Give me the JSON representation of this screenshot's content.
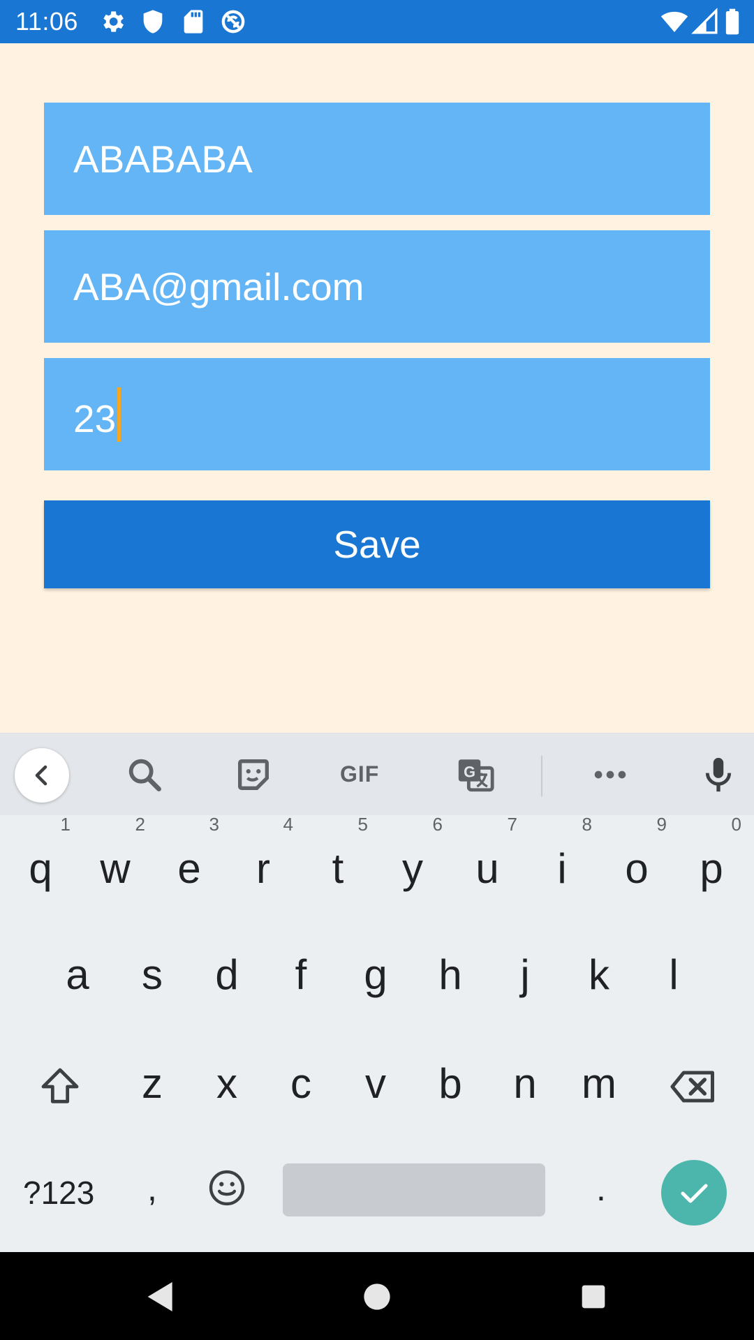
{
  "status_bar": {
    "time": "11:06",
    "left_icons": [
      "settings-icon",
      "shield-icon",
      "sd-card-icon",
      "sync-icon"
    ],
    "right_icons": [
      "wifi-icon",
      "signal-icon",
      "battery-icon"
    ],
    "background": "#1976D2"
  },
  "form": {
    "name_value": "ABABABA",
    "email_value": "ABA@gmail.com",
    "age_value": "23",
    "save_label": "Save",
    "field_color": "#64B5F6",
    "button_color": "#1976D2",
    "background": "#FFF2E0"
  },
  "keyboard": {
    "toolbar": {
      "items": [
        "back-chevron-icon",
        "search-icon",
        "sticker-icon",
        "gif",
        "translate-icon",
        "more-icon",
        "mic-icon"
      ],
      "gif_label": "GIF"
    },
    "row1": [
      {
        "key": "q",
        "hint": "1"
      },
      {
        "key": "w",
        "hint": "2"
      },
      {
        "key": "e",
        "hint": "3"
      },
      {
        "key": "r",
        "hint": "4"
      },
      {
        "key": "t",
        "hint": "5"
      },
      {
        "key": "y",
        "hint": "6"
      },
      {
        "key": "u",
        "hint": "7"
      },
      {
        "key": "i",
        "hint": "8"
      },
      {
        "key": "o",
        "hint": "9"
      },
      {
        "key": "p",
        "hint": "0"
      }
    ],
    "row2": [
      "a",
      "s",
      "d",
      "f",
      "g",
      "h",
      "j",
      "k",
      "l"
    ],
    "row3": [
      "z",
      "x",
      "c",
      "v",
      "b",
      "n",
      "m"
    ],
    "bottom": {
      "symbols_label": "?123",
      "comma": ",",
      "period": ".",
      "enter_color": "#4DB6AC"
    }
  },
  "nav_bar": {
    "buttons": [
      "back-icon",
      "home-icon",
      "recents-icon"
    ]
  }
}
